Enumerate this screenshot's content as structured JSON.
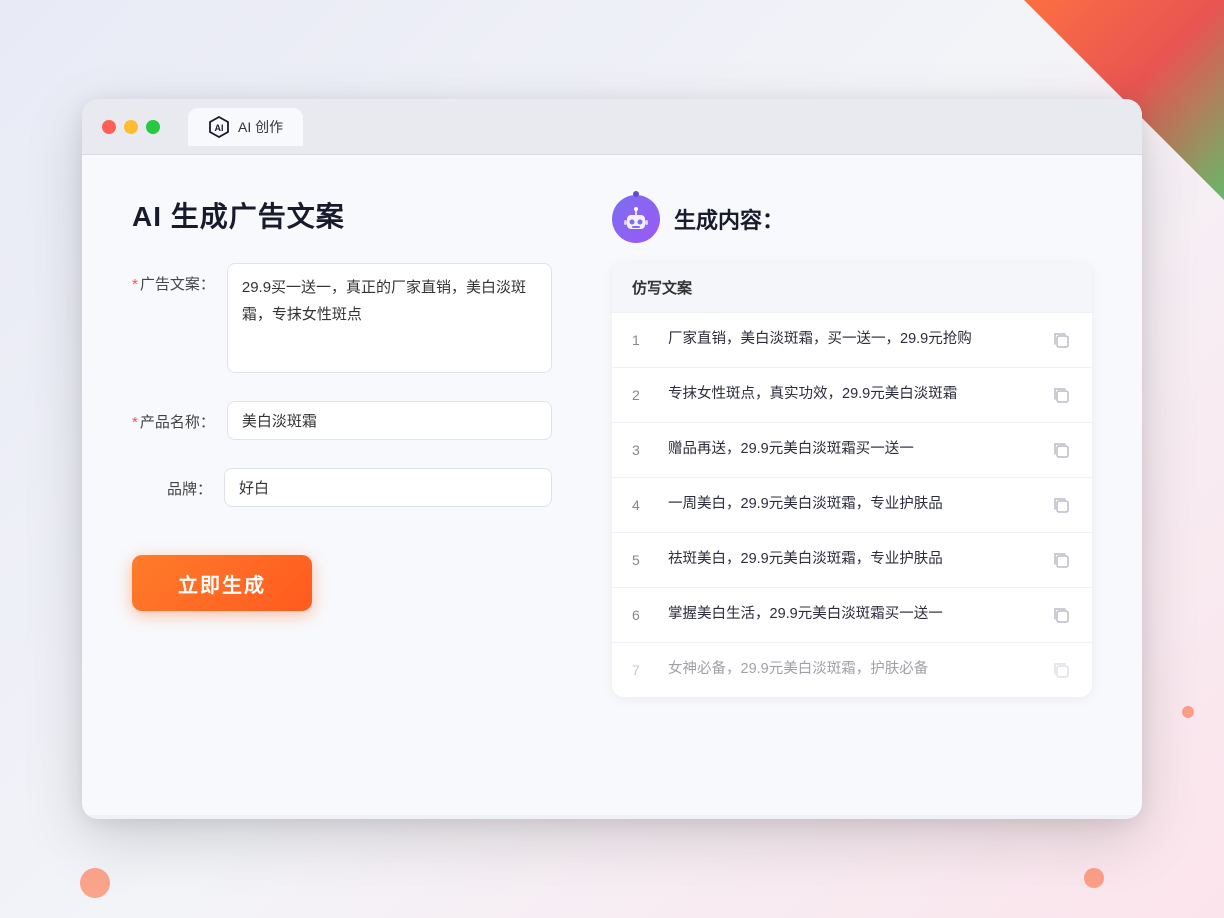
{
  "browser": {
    "tab_label": "AI 创作"
  },
  "page": {
    "title": "AI 生成广告文案",
    "right_title": "生成内容："
  },
  "form": {
    "ad_copy_label": "广告文案：",
    "ad_copy_required": true,
    "ad_copy_value": "29.9买一送一，真正的厂家直销，美白淡斑霜，专抹女性斑点",
    "product_name_label": "产品名称：",
    "product_name_required": true,
    "product_name_value": "美白淡斑霜",
    "brand_label": "品牌：",
    "brand_required": false,
    "brand_value": "好白",
    "generate_btn_label": "立即生成"
  },
  "results": {
    "section_label": "仿写文案",
    "items": [
      {
        "id": 1,
        "text": "厂家直销，美白淡斑霜，买一送一，29.9元抢购",
        "dimmed": false
      },
      {
        "id": 2,
        "text": "专抹女性斑点，真实功效，29.9元美白淡斑霜",
        "dimmed": false
      },
      {
        "id": 3,
        "text": "赠品再送，29.9元美白淡斑霜买一送一",
        "dimmed": false
      },
      {
        "id": 4,
        "text": "一周美白，29.9元美白淡斑霜，专业护肤品",
        "dimmed": false
      },
      {
        "id": 5,
        "text": "祛斑美白，29.9元美白淡斑霜，专业护肤品",
        "dimmed": false
      },
      {
        "id": 6,
        "text": "掌握美白生活，29.9元美白淡斑霜买一送一",
        "dimmed": false
      },
      {
        "id": 7,
        "text": "女神必备，29.9元美白淡斑霜，护肤必备",
        "dimmed": true
      }
    ]
  }
}
